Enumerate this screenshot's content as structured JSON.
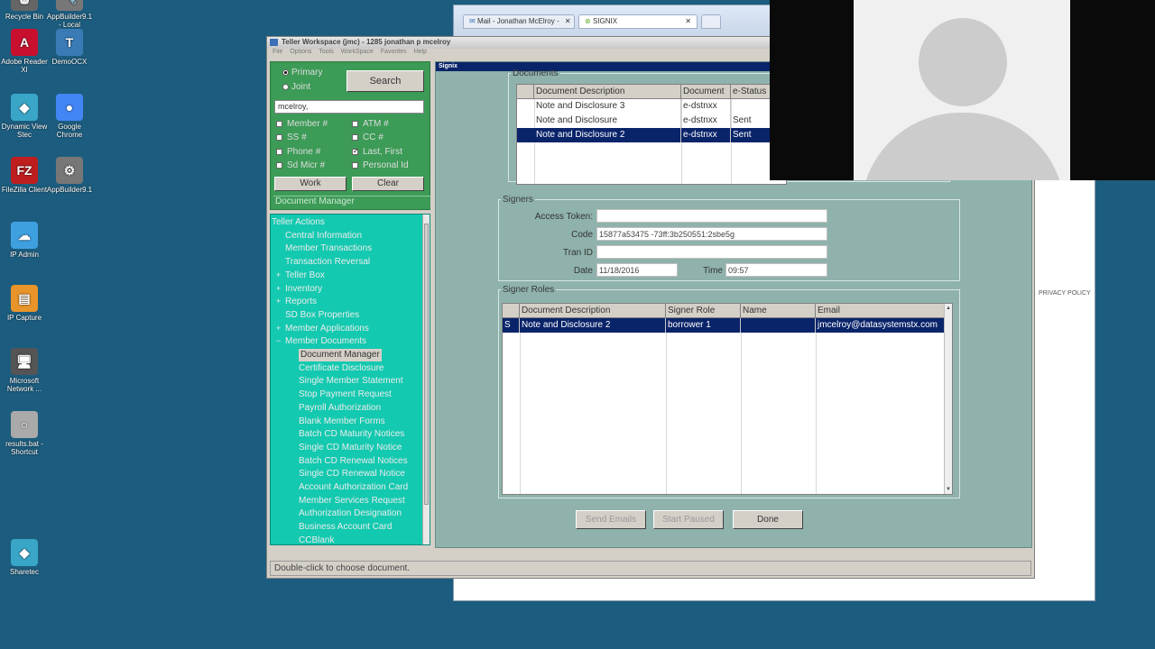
{
  "desktop": {
    "icons": [
      {
        "label": "Recycle Bin",
        "symbol": "🗑",
        "color": "#666666"
      },
      {
        "label": "AppBuilder9.1 - Local",
        "symbol": "🔧",
        "color": "#777777"
      },
      {
        "label": "Adobe Reader XI",
        "symbol": "A",
        "color": "#c8102e"
      },
      {
        "label": "DemoOCX",
        "symbol": "T",
        "color": "#3a7bb5"
      },
      {
        "label": "Dynamic View Stec",
        "symbol": "◆",
        "color": "#3aa6c7"
      },
      {
        "label": "Google Chrome",
        "symbol": "●",
        "color": "#4285f4"
      },
      {
        "label": "FileZilla Client",
        "symbol": "FZ",
        "color": "#bf1e1e"
      },
      {
        "label": "AppBuilder9.1",
        "symbol": "⚙",
        "color": "#777777"
      },
      {
        "label": "IP Admin",
        "symbol": "☁",
        "color": "#3fa0e0"
      },
      {
        "label": "IP Capture",
        "symbol": "▤",
        "color": "#e8942a"
      },
      {
        "label": "Microsoft Network ...",
        "symbol": "🖥",
        "color": "#555555"
      },
      {
        "label": "results.bat - Shortcut",
        "symbol": "○",
        "color": "#aaaaaa"
      },
      {
        "label": "Sharetec",
        "symbol": "◆",
        "color": "#3aa6c7"
      }
    ]
  },
  "browser": {
    "tabs": [
      "Mail - Jonathan McElroy -",
      "SIGNIX"
    ],
    "privacy_policy": "PRIVACY POLICY"
  },
  "teller": {
    "title": "Teller Workspace (jmc) - 1285 jonathan p mcelroy",
    "menu": [
      "File",
      "Options",
      "Tools",
      "WorkSpace",
      "Favorites",
      "Help"
    ],
    "search": {
      "radio_primary": "Primary",
      "radio_joint": "Joint",
      "search_button": "Search",
      "search_value": "mcelroy,",
      "checks": {
        "member": "Member #",
        "atm": "ATM #",
        "ss": "SS #",
        "cc": "CC #",
        "phone": "Phone #",
        "last_first": "Last, First",
        "sd_micr": "Sd Micr #",
        "personal_id": "Personal Id"
      },
      "work_button": "Work",
      "clear_button": "Clear",
      "panel_header": "Document Manager"
    },
    "tree": {
      "items": [
        "Teller Actions",
        "Central Information",
        "Member Transactions",
        "Transaction Reversal",
        "Teller Box",
        "Inventory",
        "Reports",
        "SD Box Properties",
        "Member Applications",
        "Member Documents",
        "Document Manager",
        "Certificate Disclosure",
        "Single Member Statement",
        "Stop Payment Request",
        "Payroll Authorization",
        "Blank Member Forms",
        "Batch CD Maturity Notices",
        "Single CD Maturity Notice",
        "Batch CD Renewal Notices",
        "Single CD Renewal Notice",
        "Account Authorization Card",
        "Member Services Request",
        "Authorization Designation",
        "Business Account Card",
        "CCBlank"
      ],
      "expanders": [
        "+",
        "+",
        "+",
        "+",
        "−"
      ]
    },
    "signix": {
      "title": "Signix",
      "documents": {
        "legend": "Documents",
        "headers": [
          "Document Description",
          "Document",
          "e-Status"
        ],
        "rows": [
          [
            "Note and Disclosure 3",
            "e-dstnxx",
            ""
          ],
          [
            "Note and Disclosure",
            "e-dstnxx",
            "Sent"
          ],
          [
            "Note and Disclosure 2",
            "e-dstnxx",
            "Sent"
          ]
        ]
      },
      "signers": {
        "legend": "Signers",
        "access_token_label": "Access Token:",
        "access_token": "",
        "code_label": "Code",
        "code": "15877a53475 -73ff:3b250551:2sbe5g",
        "tran_id_label": "Tran ID",
        "tran_id": "",
        "date_label": "Date",
        "date": "11/18/2016",
        "time_label": "Time",
        "time": "09:57"
      },
      "signer_roles": {
        "legend": "Signer Roles",
        "headers": [
          "",
          "Document Description",
          "Signer Role",
          "Name",
          "Email"
        ],
        "rows": [
          [
            "S",
            "Note and Disclosure 2",
            "borrower 1",
            "",
            "jmcelroy@datasystemstx.com"
          ]
        ]
      },
      "buttons": {
        "send_emails": "Send Emails",
        "start_paused": "Start Paused",
        "done": "Done"
      }
    },
    "status": "Double-click to choose document."
  }
}
